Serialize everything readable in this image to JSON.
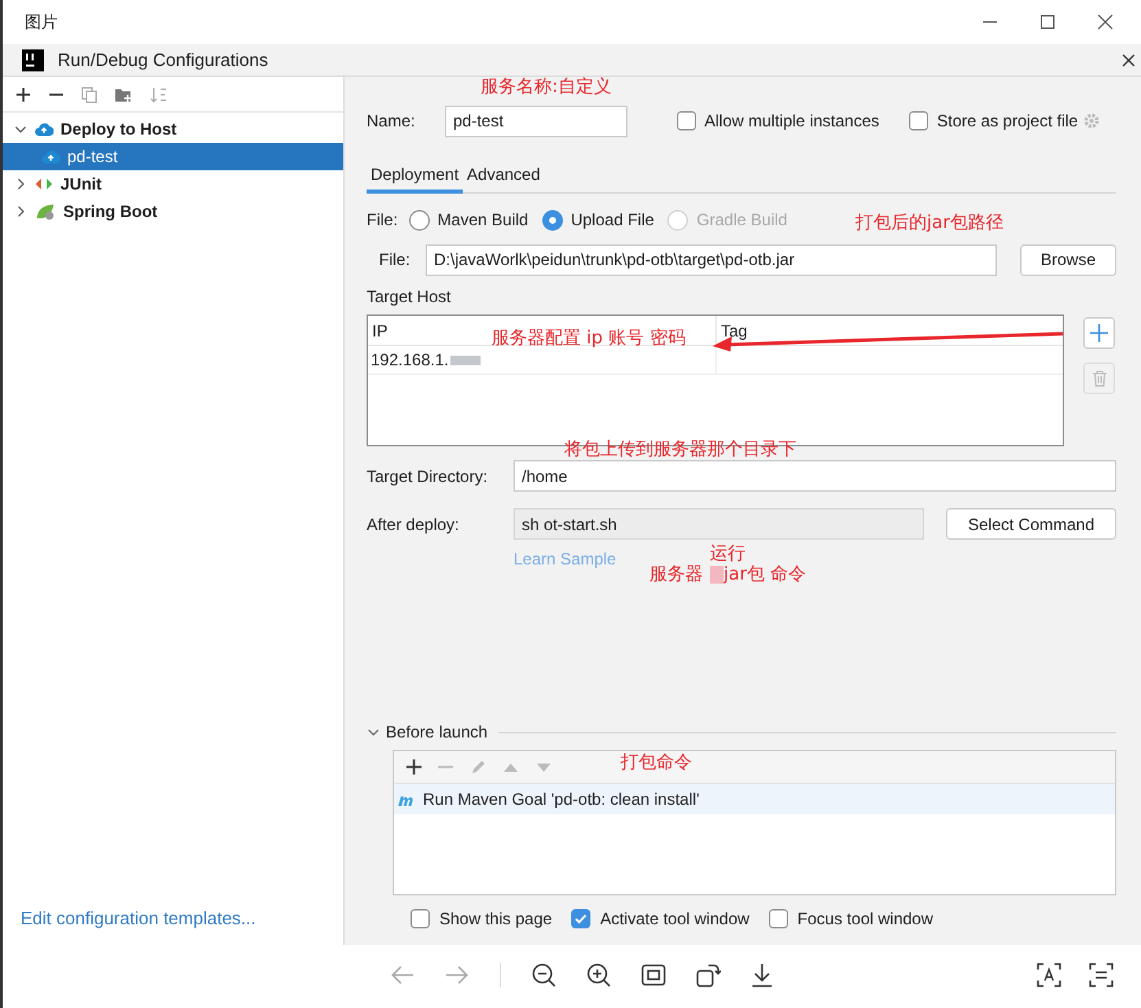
{
  "viewer": {
    "title": "图片"
  },
  "dialog": {
    "title": "Run/Debug Configurations"
  },
  "sidebar": {
    "tree": [
      {
        "label": "Deploy to Host",
        "kind": "deploy",
        "expanded": true,
        "selected": false,
        "children": [
          {
            "label": "pd-test",
            "kind": "deploy",
            "selected": true
          }
        ]
      },
      {
        "label": "JUnit",
        "kind": "junit",
        "expanded": false,
        "selected": false
      },
      {
        "label": "Spring Boot",
        "kind": "spring",
        "expanded": false,
        "selected": false
      }
    ],
    "footer_link": "Edit configuration templates..."
  },
  "name_field": {
    "label": "Name:",
    "value": "pd-test"
  },
  "options": [
    {
      "label": "Allow multiple instances",
      "checked": false
    },
    {
      "label": "Store as project file",
      "checked": false
    }
  ],
  "tabs": [
    {
      "label": "Deployment",
      "selected": true
    },
    {
      "label": "Advanced",
      "selected": false
    }
  ],
  "file_source": {
    "label": "File:",
    "options": [
      {
        "label": "Maven Build",
        "selected": false,
        "disabled": false
      },
      {
        "label": "Upload File",
        "selected": true,
        "disabled": false
      },
      {
        "label": "Gradle Build",
        "selected": false,
        "disabled": true
      }
    ]
  },
  "file_path": {
    "label": "File:",
    "value": "D:\\javaWorlk\\peidun\\trunk\\pd-otb\\target\\pd-otb.jar",
    "button": "Browse"
  },
  "target_host": {
    "label": "Target Host",
    "columns": [
      "IP",
      "Tag"
    ],
    "rows": [
      [
        "192.168.1.",
        ""
      ]
    ]
  },
  "target_directory": {
    "label": "Target Directory:",
    "value": "/home"
  },
  "after_deploy": {
    "label": "After deploy:",
    "value": "sh ot-start.sh",
    "button": "Select Command",
    "link": "Learn Sample"
  },
  "before_launch": {
    "title": "Before launch",
    "expanded": true,
    "tasks": [
      "Run Maven Goal 'pd-otb: clean install'"
    ]
  },
  "launch_options": [
    {
      "label": "Show this page",
      "checked": false
    },
    {
      "label": "Activate tool window",
      "checked": true
    },
    {
      "label": "Focus tool window",
      "checked": false
    }
  ],
  "annotations": [
    "服务名称:自定义",
    "打包后的jar包路径",
    "服务器配置 ip 账号 密码",
    "将包上传到服务器那个目录下",
    "运行",
    "服务器",
    "jar包 命令",
    "打包命令"
  ]
}
